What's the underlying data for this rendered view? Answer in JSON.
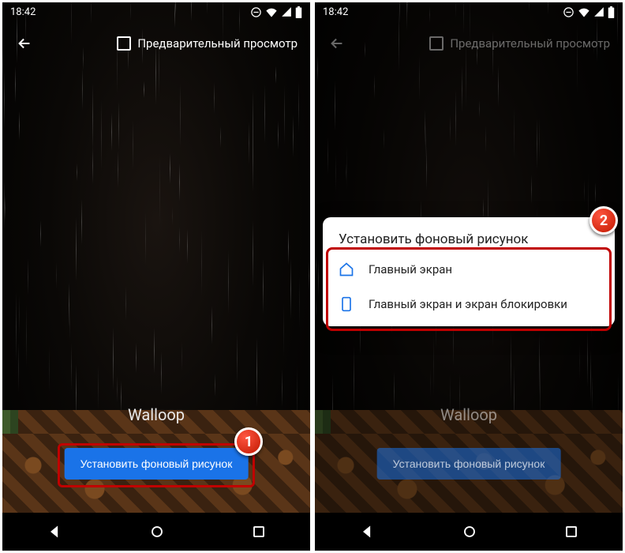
{
  "status": {
    "time": "18:42"
  },
  "appbar": {
    "preview_label": "Предварительный просмотр"
  },
  "main": {
    "app_title": "Walloop",
    "set_button": "Установить фоновый рисунок"
  },
  "dialog": {
    "title": "Установить фоновый рисунок",
    "option_home": "Главный экран",
    "option_both": "Главный экран и экран блокировки"
  },
  "badges": {
    "one": "1",
    "two": "2"
  },
  "colors": {
    "accent": "#1a73e8",
    "highlight": "#c00000"
  }
}
